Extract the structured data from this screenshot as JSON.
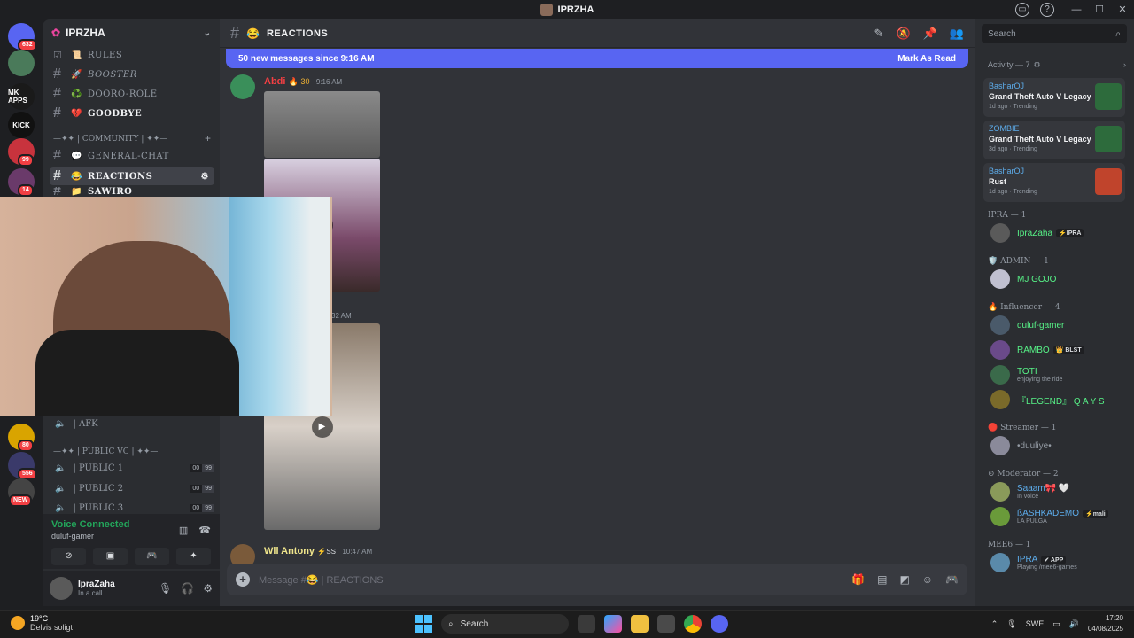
{
  "window": {
    "title": "IPRZHA"
  },
  "servers": [
    {
      "label": "",
      "color": "#5865f2",
      "badge": "632"
    },
    {
      "label": "",
      "color": "#4a7a5a",
      "badge": ""
    },
    {
      "label": "MK APPS",
      "color": "#1a1a1a",
      "badge": ""
    },
    {
      "label": "KICK",
      "color": "#111111",
      "badge": ""
    },
    {
      "label": "",
      "color": "#c8333d",
      "badge": "99"
    },
    {
      "label": "",
      "color": "#6a3a6a",
      "badge": "14"
    },
    {
      "label": "",
      "color": "#d9a400",
      "badge": "80"
    },
    {
      "label": "",
      "color": "#3a3a6a",
      "badge": "556"
    },
    {
      "label": "",
      "color": "#444444",
      "badge": "NEW"
    }
  ],
  "sidebar": {
    "server_name": "IPRZHA",
    "channels": [
      {
        "icon": "📜",
        "name": "RULES",
        "style": "normal"
      },
      {
        "icon": "🚀",
        "name": "BOOSTER",
        "style": "italic"
      },
      {
        "icon": "♻️",
        "name": "DOORO-ROLE",
        "style": "normal"
      },
      {
        "icon": "💔",
        "name": "GOODBYE",
        "style": "bright"
      }
    ],
    "community_category": "—✦✦ | COMMUNITY | ✦✦—",
    "community_channels": [
      {
        "icon": "💬",
        "name": "GENERAL-CHAT"
      },
      {
        "icon": "😂",
        "name": "REACTIONS"
      },
      {
        "icon": "📁",
        "name": "SAWIRO"
      }
    ],
    "afk_label": "| AFK",
    "public_vc_category": "—✦✦ | PUBLIC VC | ✦✦—",
    "voice_channels": [
      {
        "name": "| PUBLIC 1",
        "count": "00",
        "limit": "99"
      },
      {
        "name": "| PUBLIC 2",
        "count": "00",
        "limit": "99"
      },
      {
        "name": "| PUBLIC 3",
        "count": "00",
        "limit": "99"
      }
    ]
  },
  "voice_panel": {
    "status": "Voice Connected",
    "channel": "duluf-gamer"
  },
  "user_panel": {
    "name": "IpraZaha",
    "status": "In a call"
  },
  "chat": {
    "channel_name": "REACTIONS",
    "channel_emoji": "😂",
    "banner_text": "50 new messages since 9:16 AM",
    "banner_action": "Mark As Read",
    "messages": [
      {
        "author": "Abdi",
        "flair": "🔥 30",
        "time": "9:16 AM",
        "color": "#f23f43"
      },
      {
        "author": "Wll Antony",
        "flair": "⚡SS",
        "time": "10:47 AM",
        "color": "#f0e68c"
      }
    ],
    "second_time": "32 AM",
    "placeholder": "Message #😂 | REACTIONS"
  },
  "right": {
    "search_placeholder": "Search",
    "activity_header": "Activity — 7",
    "activities": [
      {
        "user": "BasharOJ",
        "game": "Grand Theft Auto V Legacy",
        "meta": "1d ago · Trending",
        "icon_color": "#2d6b3c"
      },
      {
        "user": "ZOMBIE",
        "game": "Grand Theft Auto V Legacy",
        "meta": "3d ago · Trending",
        "icon_color": "#2d6b3c"
      },
      {
        "user": "BasharOJ",
        "game": "Rust",
        "meta": "1d ago · Trending",
        "icon_color": "#c0442c"
      }
    ],
    "groups": [
      {
        "title": "IPRA — 1",
        "members": [
          {
            "name": "IpraZaha",
            "tag": "⚡IPRA",
            "sub": "",
            "color": "#57f287"
          }
        ]
      },
      {
        "title": "🛡️ ADMIN — 1",
        "members": [
          {
            "name": "MJ GOJO",
            "tag": "",
            "sub": "",
            "color": "#57f287"
          }
        ]
      },
      {
        "title": "🔥 Influencer — 4",
        "members": [
          {
            "name": "duluf-gamer",
            "tag": "",
            "sub": "",
            "color": "#57f287"
          },
          {
            "name": "RAMBO",
            "tag": "👑 BLST",
            "sub": "",
            "color": "#57f287"
          },
          {
            "name": "TOTI",
            "tag": "",
            "sub": "enjoying the ride",
            "color": "#57f287"
          },
          {
            "name": "『LEGEND』 Q A Y S",
            "tag": "",
            "sub": "",
            "color": "#57f287"
          }
        ]
      },
      {
        "title": "🔴 Streamer — 1",
        "members": [
          {
            "name": "•duuliye•",
            "tag": "",
            "sub": "",
            "color": "#949ba4"
          }
        ]
      },
      {
        "title": "⊙ Moderator — 2",
        "members": [
          {
            "name": "Saaam🎀 🤍",
            "tag": "",
            "sub": "In voice",
            "color": "#5dadec"
          },
          {
            "name": "ßASHKADEMO",
            "tag": "⚡mali",
            "sub": "LA PULGA",
            "color": "#5dadec"
          }
        ]
      },
      {
        "title": "MEE6 — 1",
        "members": [
          {
            "name": "IPRA",
            "tag": "✔ APP",
            "sub": "Playing /mee6-games",
            "color": "#5dadec"
          }
        ]
      }
    ]
  },
  "taskbar": {
    "temp": "19°C",
    "weather": "Delvis soligt",
    "search": "Search",
    "lang": "SWE",
    "time": "17:20",
    "date": "04/08/2025"
  }
}
